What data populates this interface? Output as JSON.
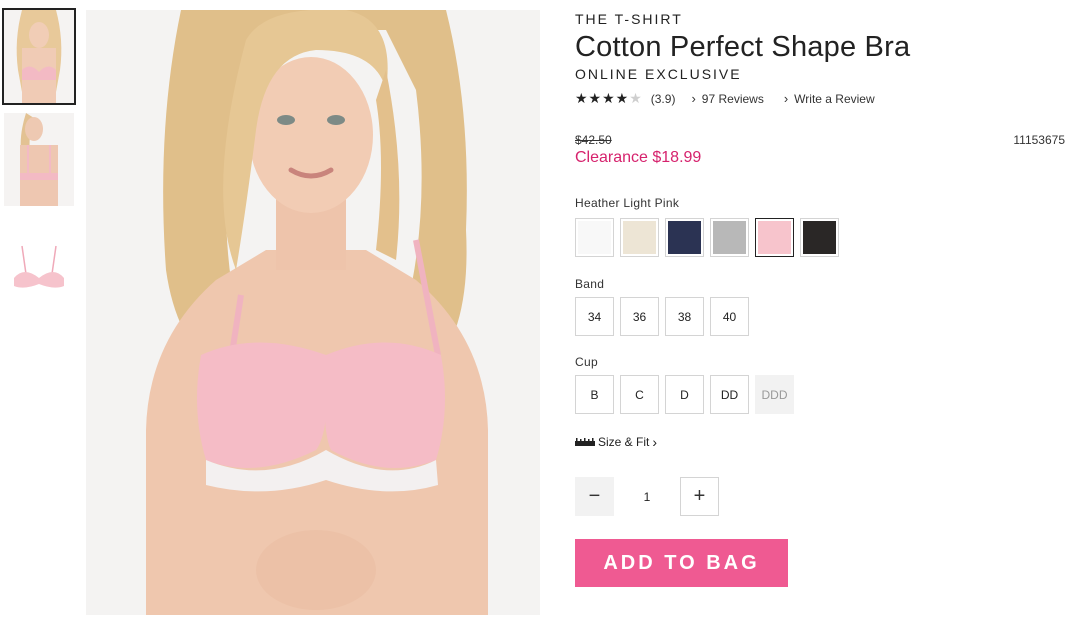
{
  "product": {
    "collection": "THE T-SHIRT",
    "title": "Cotton Perfect Shape Bra",
    "tag": "ONLINE EXCLUSIVE",
    "rating_value": 3.9,
    "rating_text": "(3.9)",
    "stars": "★★★★",
    "empty_star": "★",
    "reviews_link": "97 Reviews",
    "write_review_link": "Write a Review",
    "original_price": "$42.50",
    "sale_price": "Clearance $18.99",
    "sku": "11153675"
  },
  "color": {
    "selected_name": "Heather Light Pink",
    "swatches": [
      {
        "name": "white",
        "hex": "#f8f8f8",
        "selected": false
      },
      {
        "name": "beige",
        "hex": "#ede5d5",
        "selected": false
      },
      {
        "name": "navy",
        "hex": "#2b3353",
        "selected": false
      },
      {
        "name": "heather-grey",
        "hex": "#b8b8b8",
        "selected": false
      },
      {
        "name": "heather-light-pink",
        "hex": "#f7c4cc",
        "selected": true
      },
      {
        "name": "black",
        "hex": "#2a2726",
        "selected": false
      }
    ]
  },
  "band": {
    "label": "Band",
    "options": [
      "34",
      "36",
      "38",
      "40"
    ]
  },
  "cup": {
    "label": "Cup",
    "options": [
      "B",
      "C",
      "D",
      "DD",
      "DDD"
    ],
    "disabled": [
      "DDD"
    ]
  },
  "size_fit": {
    "label": "Size & Fit",
    "icon": "ruler-icon",
    "chevron": "›"
  },
  "quantity": {
    "value": "1",
    "minus": "−",
    "plus": "+"
  },
  "cta": {
    "add_to_bag": "ADD TO BAG"
  },
  "gallery": {
    "thumbnails": [
      "front-view",
      "back-view",
      "product-flat"
    ],
    "active_index": 0
  },
  "colors": {
    "accent_pink": "#ef5a92",
    "clearance_red": "#d6226d"
  }
}
